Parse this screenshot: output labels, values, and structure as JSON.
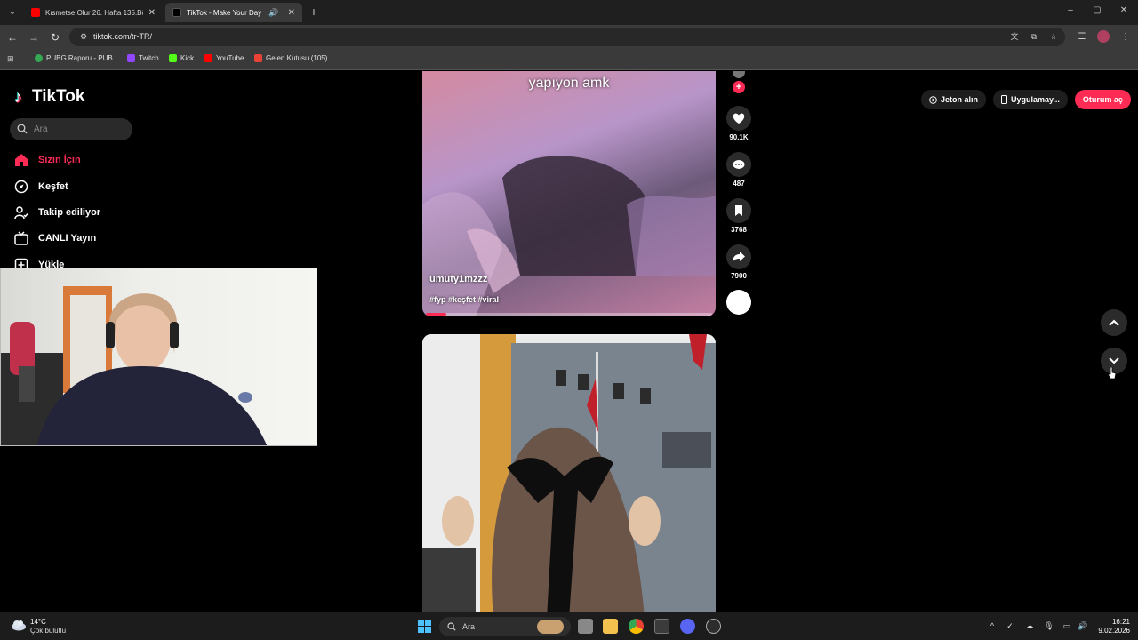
{
  "browser": {
    "tabs": [
      {
        "title": "Kısmetse Olur 26. Hafta 135.Bö",
        "favicon_color": "#ff0000"
      },
      {
        "title": "TikTok - Make Your Day",
        "favicon_color": "#000000"
      }
    ],
    "url": "tiktok.com/tr-TR/",
    "bookmarks": [
      {
        "label": "PUBG Raporu - PUB...",
        "color": "#34a853"
      },
      {
        "label": "Twitch",
        "color": "#9146ff"
      },
      {
        "label": "Kick",
        "color": "#53fc18"
      },
      {
        "label": "YouTube",
        "color": "#ff0000"
      },
      {
        "label": "Gelen Kutusu (105)...",
        "color": "#ea4335"
      }
    ]
  },
  "tiktok": {
    "brand": "TikTok",
    "search_placeholder": "Ara",
    "nav": [
      {
        "label": "Sizin İçin",
        "icon": "home-icon",
        "active": true
      },
      {
        "label": "Keşfet",
        "icon": "compass-icon",
        "active": false
      },
      {
        "label": "Takip ediliyor",
        "icon": "following-icon",
        "active": false
      },
      {
        "label": "CANLI Yayın",
        "icon": "live-tv-icon",
        "active": false
      },
      {
        "label": "Yükle",
        "icon": "upload-icon",
        "active": false
      }
    ],
    "header": {
      "coins_label": "Jeton alın",
      "app_label": "Uygulamay...",
      "login_label": "Oturum aç",
      "accent": "#fe2c55"
    },
    "video1": {
      "caption": "yapıyon amk",
      "author": "umuty1mzzz",
      "hashtags": "#fyp #keşfet #viral",
      "progress": 0.07,
      "likes": "90.1K",
      "comments": "487",
      "saves": "3768",
      "shares": "7900"
    }
  },
  "taskbar": {
    "temperature": "14°C",
    "weather": "Çok bulutlu",
    "search_label": "Ara",
    "time": "16:21",
    "date": "9.02.2026"
  }
}
